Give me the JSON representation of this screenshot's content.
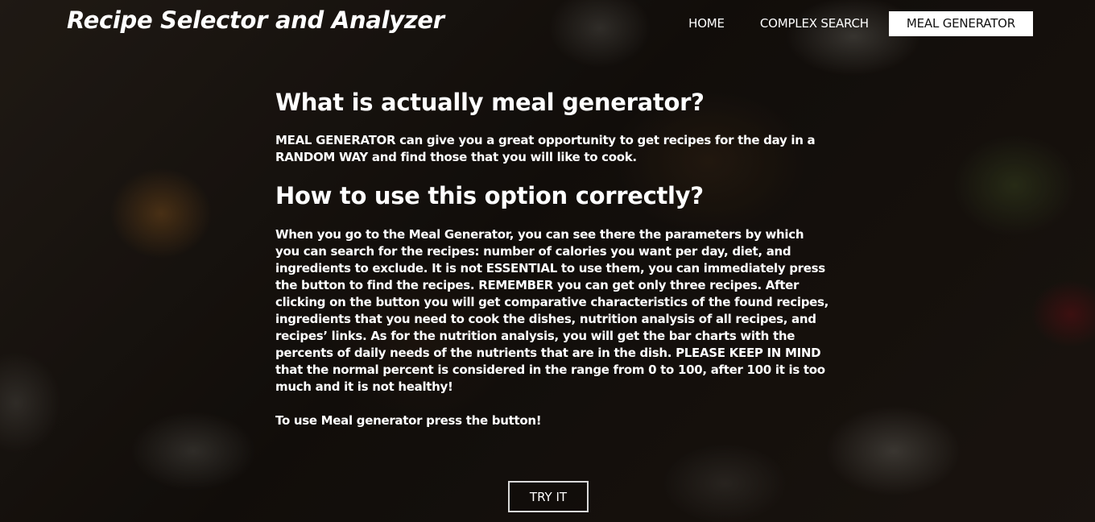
{
  "header": {
    "site_title": "Recipe Selector and Analyzer",
    "nav": {
      "home": "HOME",
      "complex_search": "COMPLEX SEARCH",
      "meal_generator": "MEAL GENERATOR"
    },
    "active_nav": "MEAL GENERATOR"
  },
  "main": {
    "heading_what": "What is actually meal generator?",
    "intro_text": "MEAL GENERATOR can give you a great opportunity to get recipes for the day in a RANDOM WAY and find those that you will like to cook.",
    "heading_how": "How to use this option correctly?",
    "usage_text": "When you go to the Meal Generator, you can see there the parameters by which you can search for the recipes: number of calories you want per day, diet, and ingredients to exclude. It is not ESSENTIAL to use them, you can immediately press the button to find the recipes. REMEMBER you can get only three recipes. After clicking on the button you will get comparative characteristics of the found recipes, ingredients that you need to cook the dishes, nutrition analysis of all recipes, and recipes’ links. As for the nutrition analysis, you will get the bar charts with the percents of daily needs of the nutrients that are in the dish. PLEASE KEEP IN MIND that the normal percent is considered in the range from 0 to 100, after 100 it is too much and it is not healthy!",
    "cta_text": "To use Meal generator press the button!",
    "try_button": "TRY IT"
  }
}
